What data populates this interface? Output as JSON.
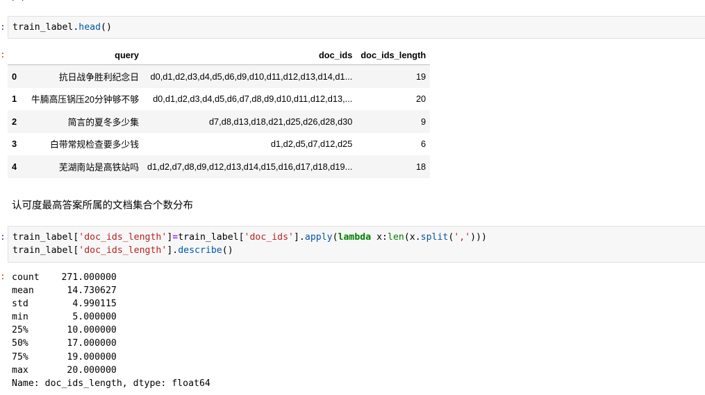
{
  "top_fragment": "(…)",
  "cell1": {
    "prompt": ":",
    "code_var": "train_label.",
    "code_fn": "head",
    "code_tail": "()"
  },
  "output1": {
    "prompt": ":",
    "columns": [
      "query",
      "doc_ids",
      "doc_ids_length"
    ],
    "rows": [
      {
        "index": "0",
        "query": "抗日战争胜利纪念日",
        "doc_ids": "d0,d1,d2,d3,d4,d5,d6,d9,d10,d11,d12,d13,d14,d1...",
        "doc_ids_length": "19"
      },
      {
        "index": "1",
        "query": "牛腩高压锅压20分钟够不够",
        "doc_ids": "d0,d1,d2,d3,d4,d5,d6,d7,d8,d9,d10,d11,d12,d13,...",
        "doc_ids_length": "20"
      },
      {
        "index": "2",
        "query": "简言的夏冬多少集",
        "doc_ids": "d7,d8,d13,d18,d21,d25,d26,d28,d30",
        "doc_ids_length": "9"
      },
      {
        "index": "3",
        "query": "白带常规检查要多少钱",
        "doc_ids": "d1,d2,d5,d7,d12,d25",
        "doc_ids_length": "6"
      },
      {
        "index": "4",
        "query": "芜湖南站是高铁站吗",
        "doc_ids": "d1,d2,d7,d8,d9,d12,d13,d14,d15,d16,d17,d18,d19...",
        "doc_ids_length": "18"
      }
    ]
  },
  "markdown_text": "认可度最高答案所属的文档集合个数分布",
  "cell2": {
    "prompt": ":",
    "line1": {
      "a": "train_label[",
      "s1": "'doc_ids_length'",
      "b": "]",
      "eq": "=",
      "c": "train_label[",
      "s2": "'doc_ids'",
      "d": "].",
      "fn1": "apply",
      "e": "(",
      "kw": "lambda",
      "f": " x:",
      "fn2": "len",
      "g": "(x.",
      "fn3": "split",
      "h": "(",
      "s3": "','",
      "i": ")))"
    },
    "line2": {
      "a": "train_label[",
      "s1": "'doc_ids_length'",
      "b": "].",
      "fn": "describe",
      "c": "()"
    }
  },
  "output2": {
    "prompt": ":",
    "text": "count    271.000000\nmean      14.730627\nstd        4.990115\nmin        5.000000\n25%       10.000000\n50%       17.000000\n75%       19.000000\nmax       20.000000\nName: doc_ids_length, dtype: float64"
  }
}
